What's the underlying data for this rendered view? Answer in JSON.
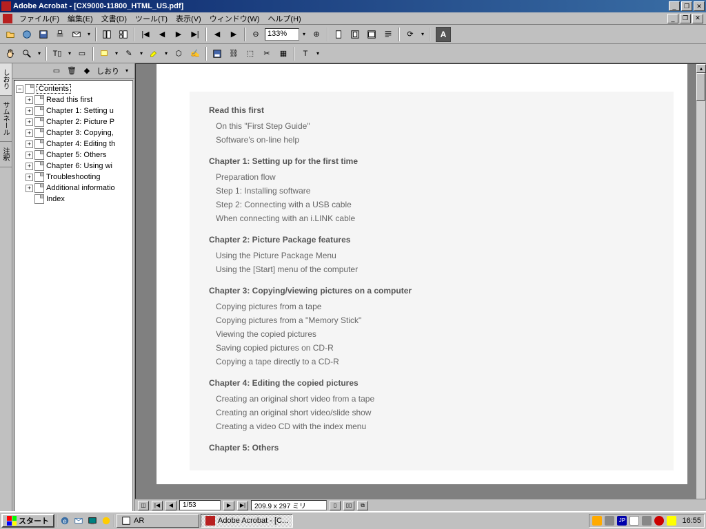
{
  "title": "Adobe Acrobat - [CX9000-11800_HTML_US.pdf]",
  "menu": {
    "file": "ファイル(F)",
    "edit": "編集(E)",
    "document": "文書(D)",
    "tools": "ツール(T)",
    "view": "表示(V)",
    "window": "ウィンドウ(W)",
    "help": "ヘルプ(H)"
  },
  "zoom": "133%",
  "bookmarks": {
    "panel_label": "しおり",
    "root": "Contents",
    "items": [
      {
        "label": "Read this first",
        "expand": true
      },
      {
        "label": "Chapter 1: Setting u",
        "expand": true
      },
      {
        "label": "Chapter 2: Picture P",
        "expand": true
      },
      {
        "label": "Chapter 3: Copying,",
        "expand": true
      },
      {
        "label": "Chapter 4: Editing th",
        "expand": true
      },
      {
        "label": "Chapter 5: Others",
        "expand": true
      },
      {
        "label": "Chapter 6: Using wi",
        "expand": true
      },
      {
        "label": "Troubleshooting",
        "expand": true
      },
      {
        "label": "Additional informatio",
        "expand": true
      },
      {
        "label": "Index",
        "expand": false
      }
    ]
  },
  "side_tabs": {
    "t1": "しおり",
    "t2": "サムネール",
    "t3": "注釈"
  },
  "toc": [
    {
      "h": "Read this first",
      "items": [
        "On this \"First Step Guide\"",
        "Software's on-line help"
      ]
    },
    {
      "h": "Chapter 1: Setting up for the first time",
      "items": [
        "Preparation flow",
        "Step 1: Installing software",
        "Step 2: Connecting with a USB cable",
        "When connecting with an i.LINK cable"
      ]
    },
    {
      "h": "Chapter 2: Picture Package features",
      "items": [
        "Using the Picture Package Menu",
        "Using the [Start] menu of the computer"
      ]
    },
    {
      "h": "Chapter 3: Copying/viewing pictures on a computer",
      "items": [
        "Copying pictures from a tape",
        "Copying pictures from a \"Memory Stick\"",
        "Viewing the copied pictures",
        "Saving copied pictures on CD-R",
        "Copying a tape directly to a CD-R"
      ]
    },
    {
      "h": "Chapter 4: Editing the copied pictures",
      "items": [
        "Creating an original short video from a tape",
        "Creating an original short video/slide show",
        "Creating a video CD with the index menu"
      ]
    },
    {
      "h": "Chapter 5: Others",
      "items": []
    }
  ],
  "status": {
    "page": "1/53",
    "dims": "209.9 x 297 ミリ"
  },
  "taskbar": {
    "start": "スタート",
    "task1": "AR",
    "task2": "Adobe Acrobat - [C...",
    "ime": "JP",
    "clock": "16:55"
  }
}
